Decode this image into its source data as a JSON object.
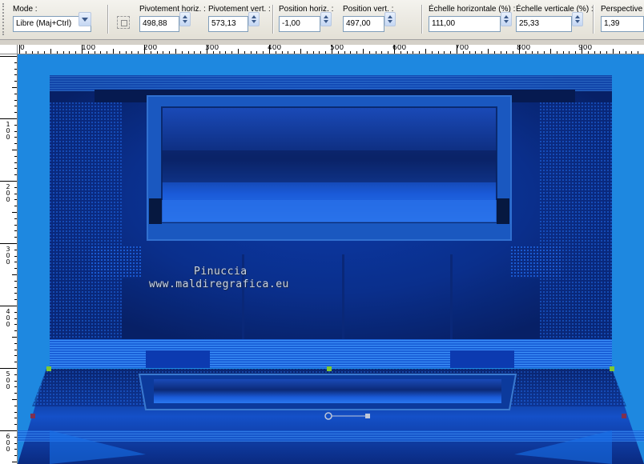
{
  "toolbar": {
    "mode": {
      "label": "Mode :",
      "value": "Libre (Maj+Ctrl)"
    },
    "pivot_h": {
      "label": "Pivotement horiz. :",
      "value": "498,88"
    },
    "pivot_v": {
      "label": "Pivotement vert. :",
      "value": "573,13"
    },
    "pos_h": {
      "label": "Position horiz. :",
      "value": "-1,00"
    },
    "pos_v": {
      "label": "Position vert. :",
      "value": "497,00"
    },
    "scale_h": {
      "label": "Échelle horizontale (%) :",
      "value": "111,00"
    },
    "scale_v": {
      "label": "Échelle verticale (%) :",
      "value": "25,33"
    },
    "perspective": {
      "label": "Perspective h",
      "value": "1,39"
    }
  },
  "ruler": {
    "h_labels": [
      "0",
      "100",
      "200",
      "300",
      "400",
      "500",
      "600",
      "700",
      "800",
      "900"
    ],
    "v_labels": [
      "1 0 0",
      "2 0 0",
      "3 0 0",
      "4 0 0",
      "5 0 0",
      "6 0 0"
    ]
  },
  "canvas": {
    "watermark_line1": "Pinuccia",
    "watermark_line2": "www.maldiregrafica.eu",
    "colors": {
      "background": "#1e88e0",
      "dark_blue": "#0a2a7a",
      "mid_blue": "#1452c8",
      "handle": "#7fc832"
    }
  }
}
